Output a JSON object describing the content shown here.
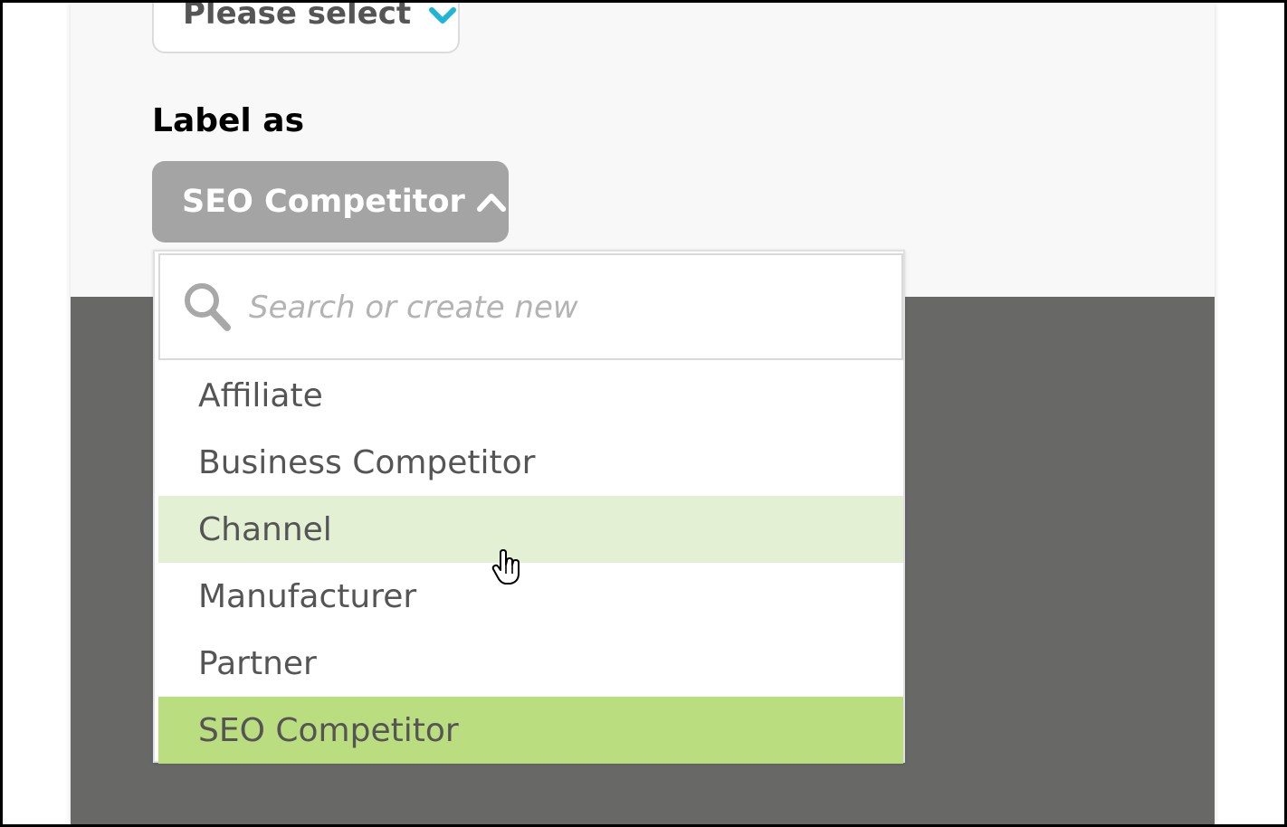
{
  "filter": {
    "please_select_label": "Please select"
  },
  "label_section": {
    "heading": "Label as",
    "selected_value": "SEO Competitor"
  },
  "dropdown": {
    "search_placeholder": "Search or create new",
    "options": [
      {
        "label": "Affiliate",
        "state": "normal"
      },
      {
        "label": "Business Competitor",
        "state": "normal"
      },
      {
        "label": "Channel",
        "state": "hover"
      },
      {
        "label": "Manufacturer",
        "state": "normal"
      },
      {
        "label": "Partner",
        "state": "normal"
      },
      {
        "label": "SEO Competitor",
        "state": "selected"
      }
    ]
  },
  "icons": {
    "please_select_chevron": "chevron-down-icon",
    "label_chevron": "chevron-up-icon",
    "search": "search-icon",
    "cursor": "hand-pointer-icon"
  },
  "colors": {
    "chevron_accent": "#1fb5d6",
    "button_bg": "#a4a4a4",
    "hover_row": "#e3f0d3",
    "selected_row": "#badd80",
    "dark_band": "#686867"
  }
}
